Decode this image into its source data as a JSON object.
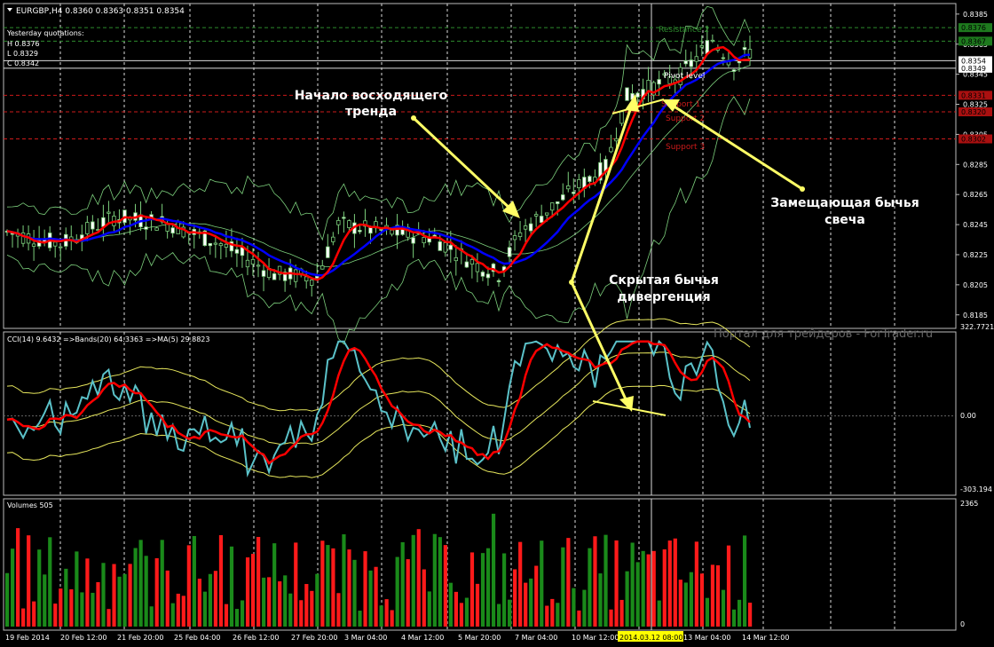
{
  "header": {
    "symbol_line": "EURGBP,H4  0.8360 0.8363 0.8351 0.8354",
    "yesterday_title": "Yesterday quotations:",
    "yesterday_high": "H 0.8376",
    "yesterday_low": "L 0.8329",
    "yesterday_close": "C 0.8342"
  },
  "price_panel": {
    "y_ticks": [
      "0.8385",
      "0.8365",
      "0.8345",
      "0.8325",
      "0.8305",
      "0.8285",
      "0.8265",
      "0.8245",
      "0.8225",
      "0.8205",
      "0.8185"
    ],
    "ylim": [
      0.8176,
      0.8392
    ],
    "level_tags": [
      {
        "value": 0.8376,
        "label": "0.8376",
        "bg": "#1e7a1e"
      },
      {
        "value": 0.8367,
        "label": "0.8367",
        "bg": "#1e7a1e"
      },
      {
        "value": 0.8354,
        "label": "0.8354",
        "bg": "#ffffff"
      },
      {
        "value": 0.8349,
        "label": "0.8349",
        "bg": "#ffffff"
      },
      {
        "value": 0.8331,
        "label": "0.8331",
        "bg": "#aa1010"
      },
      {
        "value": 0.832,
        "label": "0.8320",
        "bg": "#aa1010"
      },
      {
        "value": 0.8302,
        "label": "0.8302",
        "bg": "#aa1010"
      }
    ],
    "pivot_labels": {
      "resistance2": "Resistance 2",
      "pivot": "Pivot level",
      "support1": "Support 1",
      "support2": "Support 2",
      "support3": "Support 3"
    }
  },
  "cci_panel": {
    "title": "CCI(14) 9.6432  =>Bands(20) 64.3363  =>MA(5) 29.8823",
    "y_ticks": [
      "322.7721",
      "0.00",
      "-303.194"
    ]
  },
  "volume_panel": {
    "title": "Volumes 505",
    "y_ticks": [
      "2365",
      "0"
    ]
  },
  "x_axis": {
    "labels": [
      "19 Feb 2014",
      "20 Feb 12:00",
      "21 Feb 20:00",
      "25 Feb 04:00",
      "26 Feb 12:00",
      "27 Feb 20:00",
      "3 Mar 04:00",
      "4 Mar 12:00",
      "5 Mar 20:00",
      "7 Mar 04:00",
      "10 Mar 12:00",
      "2014.03.12 08:00",
      "13 Mar 04:00",
      "14 Mar 12:00"
    ],
    "highlight_index": 11
  },
  "annotations": {
    "trend_start": [
      "Начало восходящего",
      "тренда"
    ],
    "engulfing": [
      "Замещающая бычья",
      "свеча"
    ],
    "divergence": [
      "Скрытая бычья",
      "дивергенция"
    ],
    "watermark": "Портал для трейдеров - ForTrader.ru"
  },
  "colors": {
    "background": "#000000",
    "grid": "#c0c0c0",
    "ma_red": "#ff0000",
    "ma_blue": "#0000ff",
    "bands": "#7ccf7c",
    "cci": "#5bc2c9",
    "cci_bands": "#e6e65c",
    "volume_up": "#1a8a1a",
    "volume_down": "#ff1a1a",
    "annotation": "#ffff66"
  }
}
